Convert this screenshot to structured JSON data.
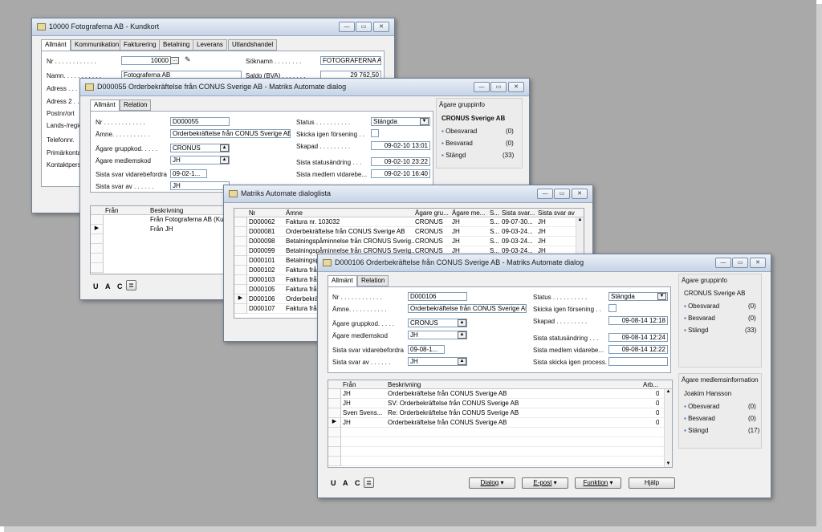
{
  "win1": {
    "title": "10000 Fotograferna AB - Kundkort",
    "tabs": [
      "Allmänt",
      "Kommunikation",
      "Fakturering",
      "Betalning",
      "Leverans",
      "Utlandshandel"
    ],
    "nr_label": "Nr . . . . . . . . . . . .",
    "nr_value": "10000",
    "name_label": "Namn. . . . . . . . . . .",
    "name_value": "Fotograferna AB",
    "sok_label": "Söknamn . . . . . . . .",
    "sok_value": "FOTOGRAFERNA AB",
    "saldo_label": "Saldo (BVA) . . . . . . .",
    "saldo_value": "29 762,50",
    "labels": [
      "Adress . . .",
      "Adress 2 . .",
      "Postnr/ort",
      "Lands-/regio",
      "Telefonnr.",
      "Primärkonta",
      "Kontaktpers"
    ]
  },
  "win2": {
    "title": "D000055 Orderbekräftelse från CONUS Sverige AB - Matriks Automate dialog",
    "tabs": [
      "Allmänt",
      "Relation"
    ],
    "nr_label": "Nr . . . . . . . . . . . .",
    "nr_value": "D000055",
    "amne_label": "Ämne. . . . . . . . . . .",
    "amne_value": "Orderbekräftelse från CONUS Sverige AB",
    "grupp_label": "Ägare gruppkod. . . . .",
    "grupp_value": "CRONUS",
    "medlem_label": "Ägare medlemskod",
    "medlem_value": "JH",
    "vidare_label": "Sista svar vidarebefordra",
    "vidare_value": "09-02-1...",
    "svarav_label": "Sista svar av . . . . . .",
    "svarav_value": "JH",
    "status_label": "Status . . . . . . . . . .",
    "status_value": "Stängda",
    "skicka_label": "Skicka igen försening . .",
    "skapad_label": "Skapad . . . . . . . . .",
    "skapad_value": "09-02-10 13:01",
    "statusandr_label": "Sista statusändring . . .",
    "statusandr_value": "09-02-10 23:22",
    "medlemvid_label": "Sista medlem vidarebe...",
    "medlemvid_value": "09-02-10 16:40",
    "info_title": "Ägare gruppinfo",
    "info_name": "CRONUS Sverige AB",
    "info_rows": [
      {
        "label": "Obesvarad",
        "value": "(0)"
      },
      {
        "label": "Besvarad",
        "value": "(0)"
      },
      {
        "label": "Stängd",
        "value": "(33)"
      }
    ],
    "grid_headers": [
      "Från",
      "Beskrivning"
    ],
    "grid_rows": [
      {
        "from": "",
        "desc": "Från Fotograferna AB (Ku"
      },
      {
        "from": "",
        "desc": "Från JH"
      }
    ],
    "uac": [
      "U",
      "A",
      "C"
    ]
  },
  "win3": {
    "title": "Matriks Automate dialoglista",
    "headers": [
      "Nr",
      "Ämne",
      "Ägare gru...",
      "Ägare me...",
      "S...",
      "Sista svar...",
      "Sista svar av"
    ],
    "rows": [
      {
        "nr": "D000062",
        "amne": "Faktura nr. 103032",
        "grp": "CRONUS",
        "med": "JH",
        "s": "S...",
        "svar": "09-07-30...",
        "av": "JH"
      },
      {
        "nr": "D000081",
        "amne": "Orderbekräftelse från CONUS Sverige AB",
        "grp": "CRONUS",
        "med": "JH",
        "s": "S...",
        "svar": "09-03-24...",
        "av": "JH"
      },
      {
        "nr": "D000098",
        "amne": "Betalningspåminnelse från CRONUS Sverig...",
        "grp": "CRONUS",
        "med": "JH",
        "s": "S...",
        "svar": "09-03-24...",
        "av": "JH"
      },
      {
        "nr": "D000099",
        "amne": "Betalningspåminnelse från CRONUS Sverig...",
        "grp": "CRONUS",
        "med": "JH",
        "s": "S...",
        "svar": "09-03-24...",
        "av": "JH"
      },
      {
        "nr": "D000101",
        "amne": "Betalningsp",
        "grp": "",
        "med": "",
        "s": "",
        "svar": "",
        "av": ""
      },
      {
        "nr": "D000102",
        "amne": "Faktura frå",
        "grp": "",
        "med": "",
        "s": "",
        "svar": "",
        "av": ""
      },
      {
        "nr": "D000103",
        "amne": "Faktura frå",
        "grp": "",
        "med": "",
        "s": "",
        "svar": "",
        "av": ""
      },
      {
        "nr": "D000105",
        "amne": "Faktura frå",
        "grp": "",
        "med": "",
        "s": "",
        "svar": "",
        "av": ""
      },
      {
        "nr": "D000106",
        "amne": "Orderbekrä",
        "grp": "",
        "med": "",
        "s": "",
        "svar": "",
        "av": ""
      },
      {
        "nr": "D000107",
        "amne": "Faktura frå",
        "grp": "",
        "med": "",
        "s": "",
        "svar": "",
        "av": ""
      }
    ]
  },
  "win4": {
    "title": "D000106 Orderbekräftelse från CONUS Sverige AB - Matriks Automate dialog",
    "tabs": [
      "Allmänt",
      "Relation"
    ],
    "nr_label": "Nr . . . . . . . . . . . .",
    "nr_value": "D000106",
    "amne_label": "Ämne. . . . . . . . . . .",
    "amne_value": "Orderbekräftelse från CONUS Sverige AB",
    "grupp_label": "Ägare gruppkod. . . . .",
    "grupp_value": "CRONUS",
    "medlem_label": "Ägare medlemskod",
    "medlem_value": "JH",
    "vidare_label": "Sista svar vidarebefordra",
    "vidare_value": "09-08-1...",
    "svarav_label": "Sista svar av . . . . . .",
    "svarav_value": "JH",
    "status_label": "Status . . . . . . . . . .",
    "status_value": "Stängda",
    "skicka_label": "Skicka igen försening . .",
    "skapad_label": "Skapad . . . . . . . . .",
    "skapad_value": "09-08-14 12:18",
    "statusandr_label": "Sista statusändring . . .",
    "statusandr_value": "09-08-14 12:24",
    "medlemvid_label": "Sista medlem vidarebe...",
    "medlemvid_value": "09-08-14 12:22",
    "skickaprocess_label": "Sista skicka igen process.",
    "info_title": "Ägare gruppinfo",
    "info_name": "CRONUS Sverige AB",
    "info_rows": [
      {
        "label": "Obesvarad",
        "value": "(0)"
      },
      {
        "label": "Besvarad",
        "value": "(0)"
      },
      {
        "label": "Stängd",
        "value": "(33)"
      }
    ],
    "member_title": "Ägare medlemsinformation",
    "member_name": "Joakim Hansson",
    "member_rows": [
      {
        "label": "Obesvarad",
        "value": "(0)"
      },
      {
        "label": "Besvarad",
        "value": "(0)"
      },
      {
        "label": "Stängd",
        "value": "(17)"
      }
    ],
    "grid_headers": [
      "Från",
      "Beskrivning",
      "Arb..."
    ],
    "grid_rows": [
      {
        "from": "JH",
        "desc": "Orderbekräftelse från CONUS Sverige AB",
        "arb": "0"
      },
      {
        "from": "JH",
        "desc": "SV: Orderbekräftelse från CONUS Sverige AB",
        "arb": "0"
      },
      {
        "from": "Sven Svens...",
        "desc": "Re: Orderbekräftelse från CONUS Sverige AB",
        "arb": "0"
      },
      {
        "from": "JH",
        "desc": "Orderbekräftelse från CONUS Sverige AB",
        "arb": "0"
      }
    ],
    "uac": [
      "U",
      "A",
      "C"
    ],
    "buttons": [
      "Dialog",
      "E-post",
      "Funktion",
      "Hjälp"
    ]
  }
}
